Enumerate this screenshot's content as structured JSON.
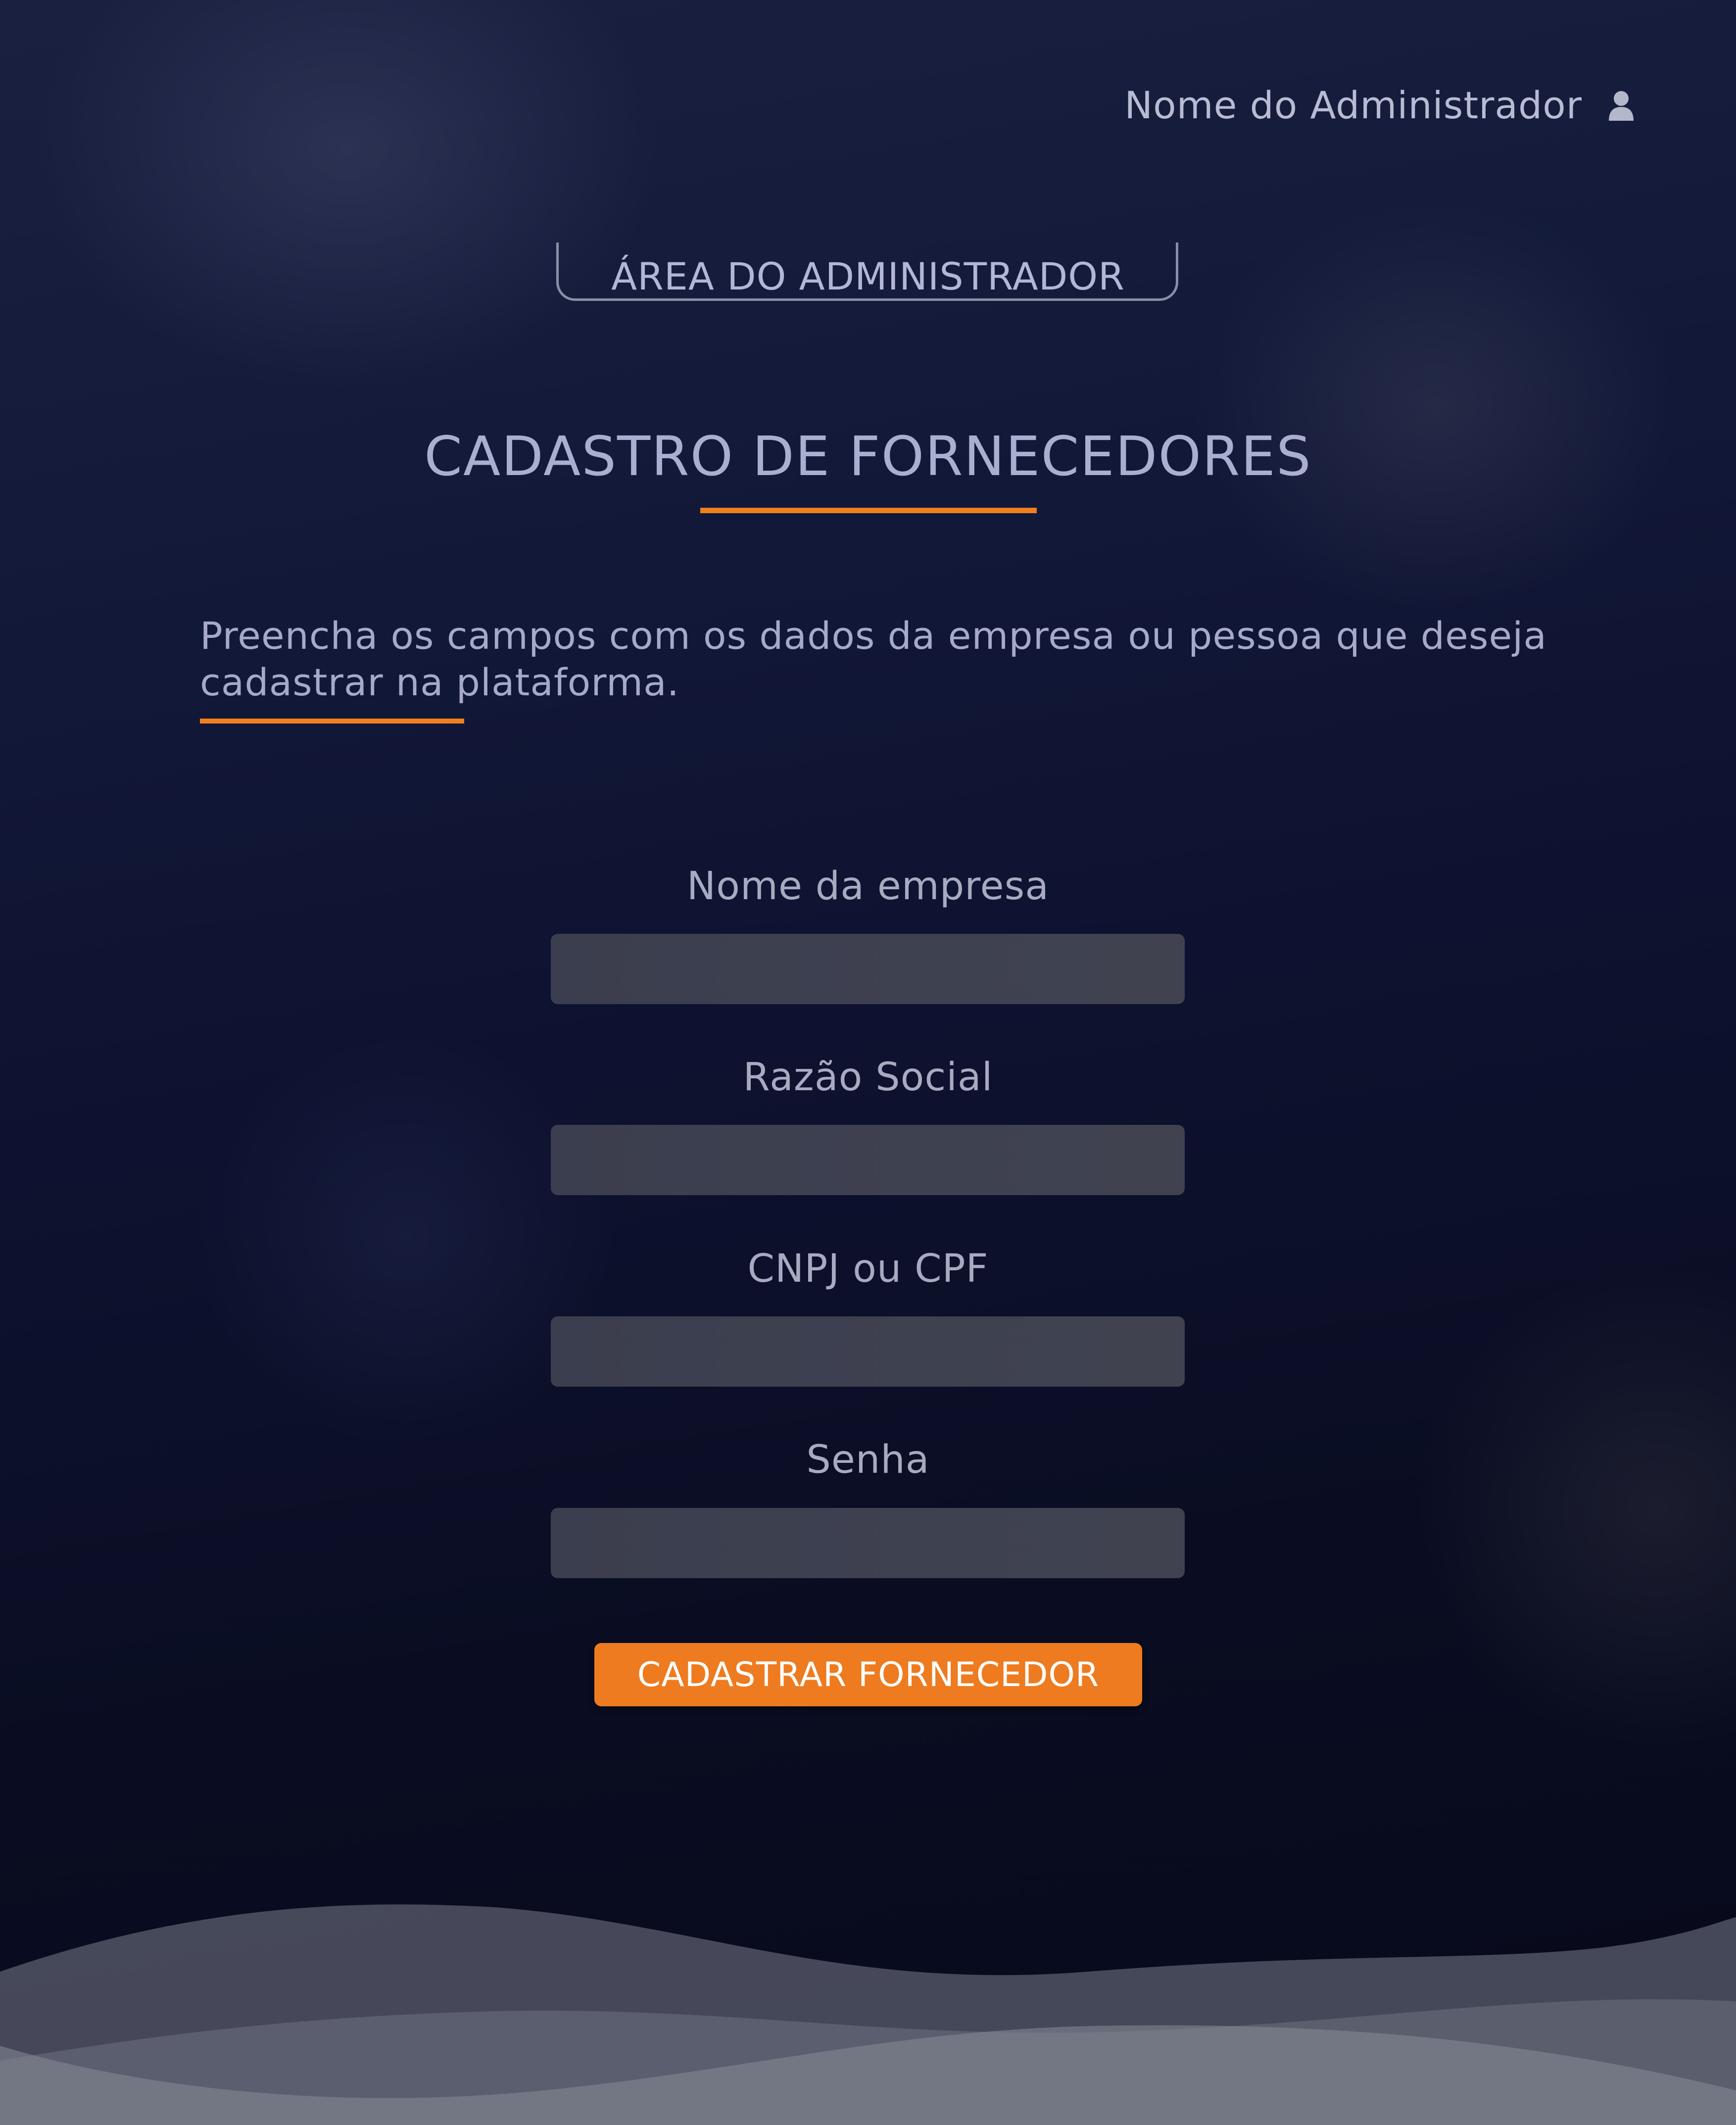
{
  "header": {
    "user_name": "Nome do Administrador",
    "user_icon": "user-icon"
  },
  "area": {
    "label": "ÁREA DO ADMINISTRADOR"
  },
  "page": {
    "title": "CADASTRO DE FORNECEDORES",
    "description": "Preencha os campos com os dados da empresa ou pessoa que deseja cadastrar na plataforma."
  },
  "form": {
    "fields": [
      {
        "label": "Nome da empresa",
        "value": ""
      },
      {
        "label": "Razão Social",
        "value": ""
      },
      {
        "label": "CNPJ ou CPF",
        "value": ""
      },
      {
        "label": "Senha",
        "value": ""
      }
    ],
    "submit_label": "CADASTRAR FORNECEDOR"
  },
  "colors": {
    "accent": "#F07F1E",
    "background": "#0E1230",
    "input": "#3D4050",
    "text": "#A8AAC0"
  }
}
